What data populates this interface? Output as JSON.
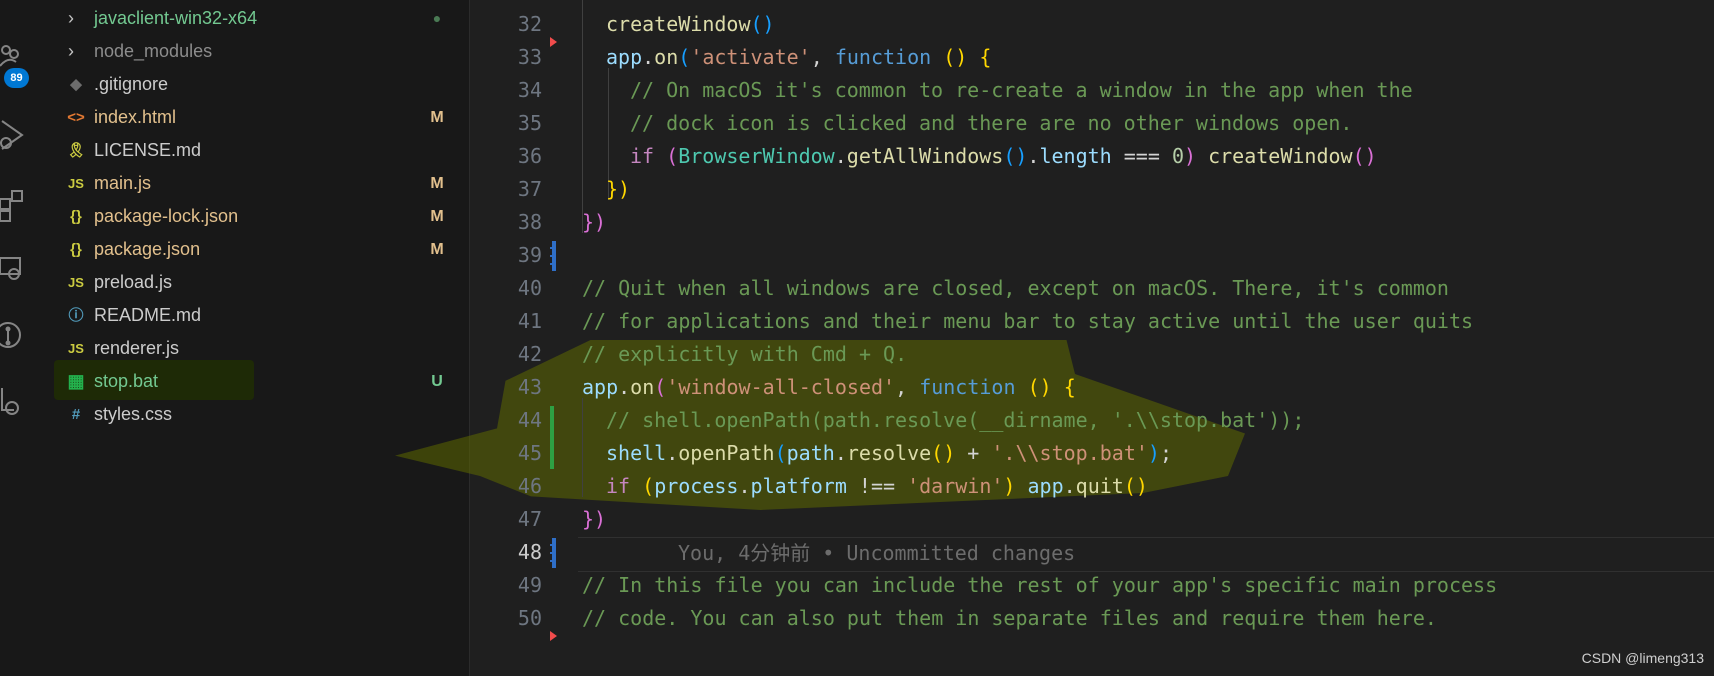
{
  "activity_bar": {
    "source_control_badge": "89"
  },
  "explorer": {
    "files": [
      {
        "name": "javaclient-win32-x64",
        "icon": "chevron-right-icon",
        "status": "●",
        "color": "#73c991"
      },
      {
        "name": "node_modules",
        "icon": "chevron-right-icon",
        "status": "",
        "color": "#8c8c8c"
      },
      {
        "name": ".gitignore",
        "icon_glyph": "◆",
        "icon": "git-icon",
        "status": "",
        "color": "#cccccc"
      },
      {
        "name": "index.html",
        "icon_glyph": "<>",
        "icon": "html-icon",
        "status": "M",
        "color": "#e2c08d"
      },
      {
        "name": "LICENSE.md",
        "icon_glyph": "🎗",
        "icon": "license-icon",
        "status": "",
        "color": "#cccccc"
      },
      {
        "name": "main.js",
        "icon_glyph": "JS",
        "icon": "javascript-icon",
        "status": "M",
        "color": "#e2c08d"
      },
      {
        "name": "package-lock.json",
        "icon_glyph": "{}",
        "icon": "json-icon",
        "status": "M",
        "color": "#e2c08d"
      },
      {
        "name": "package.json",
        "icon_glyph": "{}",
        "icon": "json-icon",
        "status": "M",
        "color": "#e2c08d"
      },
      {
        "name": "preload.js",
        "icon_glyph": "JS",
        "icon": "javascript-icon",
        "status": "",
        "color": "#cccccc"
      },
      {
        "name": "README.md",
        "icon_glyph": "ⓘ",
        "icon": "info-icon",
        "status": "",
        "color": "#cccccc"
      },
      {
        "name": "renderer.js",
        "icon_glyph": "JS",
        "icon": "javascript-icon",
        "status": "",
        "color": "#cccccc"
      },
      {
        "name": "stop.bat",
        "icon_glyph": "▦",
        "icon": "windows-icon",
        "status": "U",
        "color": "#73c991"
      },
      {
        "name": "styles.css",
        "icon_glyph": "#",
        "icon": "css-icon",
        "status": "",
        "color": "#cccccc"
      }
    ]
  },
  "editor": {
    "line_numbers": [
      "32",
      "33",
      "34",
      "35",
      "36",
      "37",
      "38",
      "39",
      "40",
      "41",
      "42",
      "43",
      "44",
      "45",
      "46",
      "47",
      "48",
      "49",
      "50"
    ],
    "active_line": "48",
    "blame_text": "You, 4分钟前 • Uncommitted changes",
    "lines": [
      [
        {
          "t": "createWindow",
          "c": "f"
        },
        {
          "t": "()",
          "c": "b"
        }
      ],
      [
        {
          "t": "app",
          "c": "v"
        },
        {
          "t": ".",
          "c": "p"
        },
        {
          "t": "on",
          "c": "f"
        },
        {
          "t": "(",
          "c": "b"
        },
        {
          "t": "'activate'",
          "c": "s"
        },
        {
          "t": ", ",
          "c": "p"
        },
        {
          "t": "function",
          "c": "k"
        },
        {
          "t": " ",
          "c": "p"
        },
        {
          "t": "()",
          "c": "y"
        },
        {
          "t": " ",
          "c": "p"
        },
        {
          "t": "{",
          "c": "y"
        }
      ],
      [
        {
          "t": "// On macOS it's common to re-create a window in the app when the",
          "c": "c"
        }
      ],
      [
        {
          "t": "// dock icon is clicked and there are no other windows open.",
          "c": "c"
        }
      ],
      [
        {
          "t": "if",
          "c": "k2"
        },
        {
          "t": " ",
          "c": "p"
        },
        {
          "t": "(",
          "c": "m"
        },
        {
          "t": "BrowserWindow",
          "c": "t"
        },
        {
          "t": ".",
          "c": "p"
        },
        {
          "t": "getAllWindows",
          "c": "f"
        },
        {
          "t": "()",
          "c": "b"
        },
        {
          "t": ".",
          "c": "p"
        },
        {
          "t": "length",
          "c": "v"
        },
        {
          "t": " === ",
          "c": "p"
        },
        {
          "t": "0",
          "c": "n"
        },
        {
          "t": ")",
          "c": "m"
        },
        {
          "t": " ",
          "c": "p"
        },
        {
          "t": "createWindow",
          "c": "f"
        },
        {
          "t": "()",
          "c": "m"
        }
      ],
      [
        {
          "t": "})",
          "c": "y"
        }
      ],
      [
        {
          "t": "})",
          "c": "m"
        }
      ],
      [],
      [
        {
          "t": "// Quit when all windows are closed, except on macOS. There, it's common",
          "c": "c"
        }
      ],
      [
        {
          "t": "// for applications and their menu bar to stay active until the user quits",
          "c": "c"
        }
      ],
      [
        {
          "t": "// explicitly with Cmd + Q.",
          "c": "c"
        }
      ],
      [
        {
          "t": "app",
          "c": "v"
        },
        {
          "t": ".",
          "c": "p"
        },
        {
          "t": "on",
          "c": "f"
        },
        {
          "t": "(",
          "c": "m"
        },
        {
          "t": "'window-all-closed'",
          "c": "s"
        },
        {
          "t": ", ",
          "c": "p"
        },
        {
          "t": "function",
          "c": "k"
        },
        {
          "t": " ",
          "c": "p"
        },
        {
          "t": "()",
          "c": "y"
        },
        {
          "t": " ",
          "c": "p"
        },
        {
          "t": "{",
          "c": "y"
        }
      ],
      [
        {
          "t": "// shell.openPath(path.resolve(__dirname, '.\\\\stop.bat'));",
          "c": "c"
        }
      ],
      [
        {
          "t": "shell",
          "c": "v"
        },
        {
          "t": ".",
          "c": "p"
        },
        {
          "t": "openPath",
          "c": "f"
        },
        {
          "t": "(",
          "c": "b"
        },
        {
          "t": "path",
          "c": "v"
        },
        {
          "t": ".",
          "c": "p"
        },
        {
          "t": "resolve",
          "c": "f"
        },
        {
          "t": "()",
          "c": "y"
        },
        {
          "t": " + ",
          "c": "p"
        },
        {
          "t": "'.\\\\stop.bat'",
          "c": "s"
        },
        {
          "t": ")",
          "c": "b"
        },
        {
          "t": ";",
          "c": "p"
        }
      ],
      [
        {
          "t": "if",
          "c": "k2"
        },
        {
          "t": " ",
          "c": "p"
        },
        {
          "t": "(",
          "c": "y"
        },
        {
          "t": "process",
          "c": "v"
        },
        {
          "t": ".",
          "c": "p"
        },
        {
          "t": "platform",
          "c": "v"
        },
        {
          "t": " !== ",
          "c": "p"
        },
        {
          "t": "'darwin'",
          "c": "s"
        },
        {
          "t": ")",
          "c": "y"
        },
        {
          "t": " ",
          "c": "p"
        },
        {
          "t": "app",
          "c": "v"
        },
        {
          "t": ".",
          "c": "p"
        },
        {
          "t": "quit",
          "c": "f"
        },
        {
          "t": "()",
          "c": "y"
        }
      ],
      [
        {
          "t": "})",
          "c": "m"
        }
      ],
      [],
      [
        {
          "t": "// In this file you can include the rest of your app's specific main process",
          "c": "c"
        }
      ],
      [
        {
          "t": "// code. You can also put them in separate files and require them here.",
          "c": "c"
        }
      ]
    ]
  },
  "watermark": "CSDN @limeng313",
  "colors": {
    "editor_bg": "#1f1f1f",
    "sidebar_bg": "#181818",
    "modified": "#e2c08d",
    "untracked": "#73c991",
    "badge": "#0078d4",
    "comment": "#6a9955"
  }
}
